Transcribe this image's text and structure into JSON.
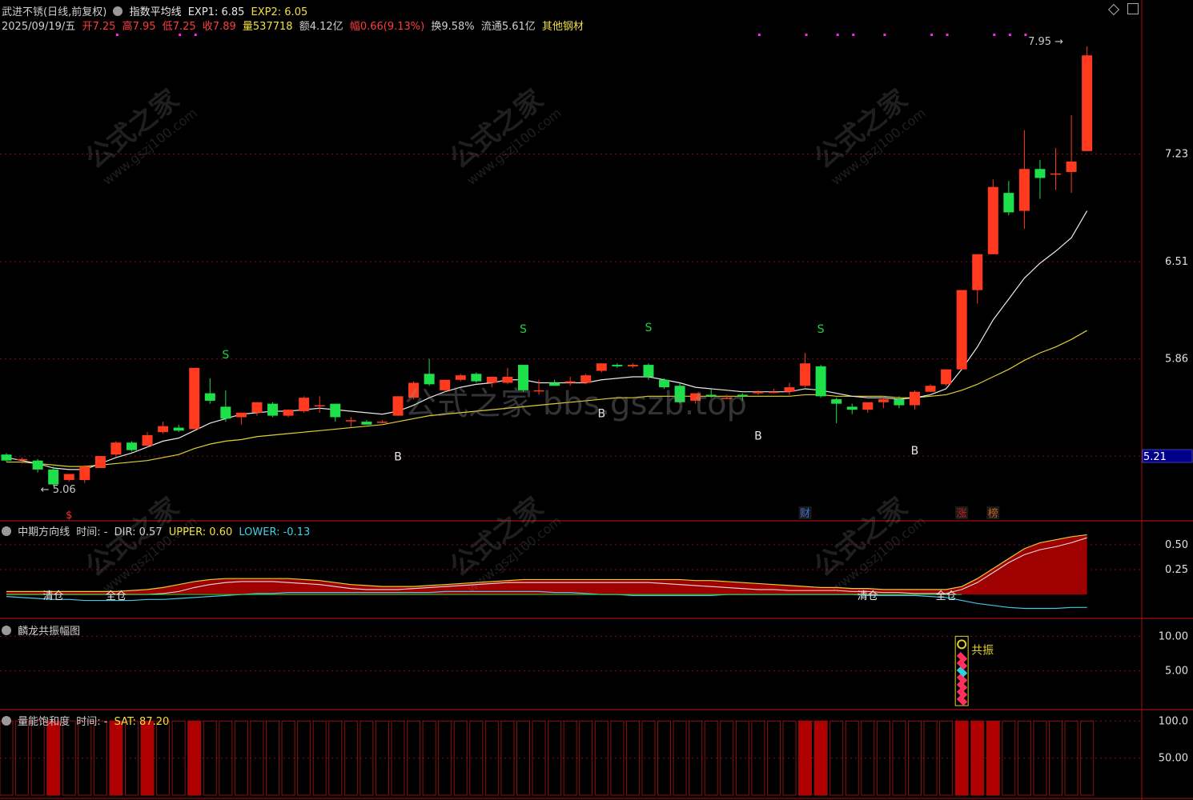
{
  "header": {
    "title": "武进不锈(日线,前复权)",
    "indicator_name": "指数平均线",
    "exp1_label": "EXP1: 6.85",
    "exp2_label": "EXP2: 6.05",
    "date": "2025/09/19/五",
    "open_label": "开",
    "open": "7.25",
    "high_label": "高",
    "high": "7.95",
    "low_label": "低",
    "low": "7.25",
    "close_label": "收",
    "close": "7.89",
    "vol_label": "量",
    "vol": "537718",
    "amount_label": "额",
    "amount": "4.12亿",
    "change_label": "幅",
    "change": "0.66(9.13%)",
    "turnover_label": "换",
    "turnover": "9.58%",
    "float_label": "流通",
    "float": "5.61亿",
    "sector": "其他钢材"
  },
  "colors": {
    "up": "#ff3a1e",
    "down": "#1ee04a",
    "ma1": "#e8e8e8",
    "ma2": "#e0d030",
    "grid": "#7a1010",
    "fill": "#b00000",
    "cyan": "#40c8e0"
  },
  "panes": {
    "mid": {
      "name": "中期方向线",
      "time": "时间: -",
      "dir": "DIR: 0.57",
      "upper": "UPPER: 0.60",
      "lower": "LOWER: -0.13",
      "signals": [
        "清仓",
        "全仓",
        "清仓",
        "全仓"
      ]
    },
    "res": {
      "name": "麟龙共振幅图",
      "tag": "共振"
    },
    "sat": {
      "name": "量能饱和度",
      "time": "时间: -",
      "value": "SAT: 87.20"
    }
  },
  "markers": {
    "low_label": "5.06",
    "high_label": "7.95",
    "current_price": "5.21",
    "badges": [
      "财",
      "涨",
      "榜"
    ],
    "sell": "S",
    "buy": "B",
    "dollar": "$"
  },
  "watermarks": {
    "cn": "公式之家",
    "url": "www.gszj100.com",
    "center": "公式之家 bbs.gszb.top"
  },
  "chart_data": [
    {
      "type": "candlestick",
      "title": "武进不锈(日线,前复权)",
      "y_ticks": [
        7.23,
        6.51,
        5.86,
        5.21
      ],
      "ylim": [
        4.9,
        7.95
      ],
      "candles": [
        {
          "o": 5.22,
          "h": 5.23,
          "c": 5.18,
          "l": 5.17
        },
        {
          "o": 5.19,
          "h": 5.2,
          "c": 5.19,
          "l": 5.16
        },
        {
          "o": 5.18,
          "h": 5.19,
          "c": 5.12,
          "l": 5.1
        },
        {
          "o": 5.12,
          "h": 5.14,
          "c": 5.02,
          "l": 5.01
        },
        {
          "o": 5.05,
          "h": 5.09,
          "c": 5.09,
          "l": 5.04
        },
        {
          "o": 5.05,
          "h": 5.15,
          "c": 5.14,
          "l": 5.03
        },
        {
          "o": 5.13,
          "h": 5.21,
          "c": 5.21,
          "l": 5.13
        },
        {
          "o": 5.22,
          "h": 5.31,
          "c": 5.3,
          "l": 5.21
        },
        {
          "o": 5.3,
          "h": 5.31,
          "c": 5.25,
          "l": 5.24
        },
        {
          "o": 5.28,
          "h": 5.37,
          "c": 5.35,
          "l": 5.27
        },
        {
          "o": 5.37,
          "h": 5.44,
          "c": 5.41,
          "l": 5.36
        },
        {
          "o": 5.4,
          "h": 5.42,
          "c": 5.38,
          "l": 5.37
        },
        {
          "o": 5.39,
          "h": 5.8,
          "c": 5.8,
          "l": 5.39
        },
        {
          "o": 5.63,
          "h": 5.73,
          "c": 5.58,
          "l": 5.56
        },
        {
          "o": 5.54,
          "h": 5.65,
          "c": 5.46,
          "l": 5.44
        },
        {
          "o": 5.47,
          "h": 5.5,
          "c": 5.5,
          "l": 5.42
        },
        {
          "o": 5.5,
          "h": 5.57,
          "c": 5.57,
          "l": 5.48
        },
        {
          "o": 5.56,
          "h": 5.57,
          "c": 5.48,
          "l": 5.47
        },
        {
          "o": 5.48,
          "h": 5.52,
          "c": 5.52,
          "l": 5.47
        },
        {
          "o": 5.51,
          "h": 5.61,
          "c": 5.6,
          "l": 5.5
        },
        {
          "o": 5.55,
          "h": 5.61,
          "c": 5.55,
          "l": 5.5
        },
        {
          "o": 5.56,
          "h": 5.56,
          "c": 5.47,
          "l": 5.44
        },
        {
          "o": 5.45,
          "h": 5.47,
          "c": 5.45,
          "l": 5.4
        },
        {
          "o": 5.44,
          "h": 5.45,
          "c": 5.42,
          "l": 5.42
        },
        {
          "o": 5.44,
          "h": 5.45,
          "c": 5.44,
          "l": 5.43
        },
        {
          "o": 5.48,
          "h": 5.61,
          "c": 5.61,
          "l": 5.48
        },
        {
          "o": 5.6,
          "h": 5.71,
          "c": 5.7,
          "l": 5.59
        },
        {
          "o": 5.76,
          "h": 5.86,
          "c": 5.69,
          "l": 5.68
        },
        {
          "o": 5.65,
          "h": 5.72,
          "c": 5.72,
          "l": 5.64
        },
        {
          "o": 5.72,
          "h": 5.76,
          "c": 5.75,
          "l": 5.71
        },
        {
          "o": 5.76,
          "h": 5.77,
          "c": 5.71,
          "l": 5.7
        },
        {
          "o": 5.7,
          "h": 5.74,
          "c": 5.74,
          "l": 5.67
        },
        {
          "o": 5.7,
          "h": 5.8,
          "c": 5.74,
          "l": 5.69
        },
        {
          "o": 5.82,
          "h": 5.82,
          "c": 5.65,
          "l": 5.64
        },
        {
          "o": 5.65,
          "h": 5.72,
          "c": 5.65,
          "l": 5.62
        },
        {
          "o": 5.7,
          "h": 5.72,
          "c": 5.68,
          "l": 5.68
        },
        {
          "o": 5.7,
          "h": 5.74,
          "c": 5.71,
          "l": 5.68
        },
        {
          "o": 5.7,
          "h": 5.76,
          "c": 5.75,
          "l": 5.69
        },
        {
          "o": 5.78,
          "h": 5.83,
          "c": 5.83,
          "l": 5.77
        },
        {
          "o": 5.82,
          "h": 5.83,
          "c": 5.81,
          "l": 5.8
        },
        {
          "o": 5.81,
          "h": 5.83,
          "c": 5.82,
          "l": 5.8
        },
        {
          "o": 5.82,
          "h": 5.83,
          "c": 5.74,
          "l": 5.72
        },
        {
          "o": 5.72,
          "h": 5.73,
          "c": 5.67,
          "l": 5.66
        },
        {
          "o": 5.68,
          "h": 5.7,
          "c": 5.57,
          "l": 5.56
        },
        {
          "o": 5.58,
          "h": 5.63,
          "c": 5.63,
          "l": 5.56
        },
        {
          "o": 5.62,
          "h": 5.66,
          "c": 5.61,
          "l": 5.6
        },
        {
          "o": 5.6,
          "h": 5.62,
          "c": 5.6,
          "l": 5.59
        },
        {
          "o": 5.62,
          "h": 5.63,
          "c": 5.61,
          "l": 5.58
        },
        {
          "o": 5.63,
          "h": 5.65,
          "c": 5.64,
          "l": 5.62
        },
        {
          "o": 5.64,
          "h": 5.66,
          "c": 5.64,
          "l": 5.63
        },
        {
          "o": 5.64,
          "h": 5.7,
          "c": 5.67,
          "l": 5.62
        },
        {
          "o": 5.68,
          "h": 5.9,
          "c": 5.83,
          "l": 5.67
        },
        {
          "o": 5.81,
          "h": 5.82,
          "c": 5.61,
          "l": 5.6
        },
        {
          "o": 5.59,
          "h": 5.6,
          "c": 5.56,
          "l": 5.43
        },
        {
          "o": 5.54,
          "h": 5.56,
          "c": 5.52,
          "l": 5.49
        },
        {
          "o": 5.52,
          "h": 5.57,
          "c": 5.57,
          "l": 5.5
        },
        {
          "o": 5.57,
          "h": 5.61,
          "c": 5.59,
          "l": 5.53
        },
        {
          "o": 5.59,
          "h": 5.61,
          "c": 5.55,
          "l": 5.53
        },
        {
          "o": 5.55,
          "h": 5.65,
          "c": 5.64,
          "l": 5.52
        },
        {
          "o": 5.64,
          "h": 5.69,
          "c": 5.68,
          "l": 5.64
        },
        {
          "o": 5.69,
          "h": 5.79,
          "c": 5.79,
          "l": 5.68
        },
        {
          "o": 5.79,
          "h": 6.32,
          "c": 6.32,
          "l": 5.79
        },
        {
          "o": 6.32,
          "h": 6.56,
          "c": 6.56,
          "l": 6.23
        },
        {
          "o": 6.56,
          "h": 7.06,
          "c": 7.01,
          "l": 6.56
        },
        {
          "o": 6.97,
          "h": 7.05,
          "c": 6.84,
          "l": 6.82
        },
        {
          "o": 6.85,
          "h": 7.39,
          "c": 7.13,
          "l": 6.73
        },
        {
          "o": 7.13,
          "h": 7.19,
          "c": 7.07,
          "l": 6.93
        },
        {
          "o": 7.1,
          "h": 7.27,
          "c": 7.1,
          "l": 6.99
        },
        {
          "o": 7.11,
          "h": 7.49,
          "c": 7.18,
          "l": 6.97
        },
        {
          "o": 7.25,
          "h": 7.95,
          "c": 7.89,
          "l": 7.25
        }
      ],
      "ma_white": [
        5.2,
        5.18,
        5.16,
        5.13,
        5.12,
        5.12,
        5.16,
        5.2,
        5.23,
        5.27,
        5.31,
        5.33,
        5.38,
        5.43,
        5.46,
        5.49,
        5.5,
        5.51,
        5.51,
        5.52,
        5.53,
        5.52,
        5.51,
        5.5,
        5.49,
        5.51,
        5.55,
        5.6,
        5.64,
        5.67,
        5.69,
        5.7,
        5.72,
        5.72,
        5.7,
        5.7,
        5.7,
        5.7,
        5.72,
        5.73,
        5.74,
        5.74,
        5.72,
        5.7,
        5.67,
        5.66,
        5.65,
        5.64,
        5.64,
        5.64,
        5.64,
        5.66,
        5.65,
        5.63,
        5.61,
        5.6,
        5.6,
        5.59,
        5.6,
        5.62,
        5.66,
        5.79,
        5.94,
        6.12,
        6.26,
        6.4,
        6.5,
        6.58,
        6.67,
        6.85
      ],
      "ma_yellow": [
        5.17,
        5.17,
        5.16,
        5.15,
        5.14,
        5.14,
        5.15,
        5.16,
        5.17,
        5.18,
        5.2,
        5.22,
        5.26,
        5.29,
        5.31,
        5.32,
        5.34,
        5.35,
        5.36,
        5.37,
        5.38,
        5.39,
        5.4,
        5.41,
        5.42,
        5.44,
        5.46,
        5.48,
        5.49,
        5.5,
        5.51,
        5.52,
        5.53,
        5.54,
        5.55,
        5.56,
        5.57,
        5.58,
        5.59,
        5.6,
        5.6,
        5.61,
        5.61,
        5.61,
        5.61,
        5.61,
        5.61,
        5.61,
        5.61,
        5.61,
        5.61,
        5.62,
        5.62,
        5.61,
        5.61,
        5.61,
        5.61,
        5.6,
        5.6,
        5.61,
        5.62,
        5.65,
        5.69,
        5.74,
        5.79,
        5.85,
        5.9,
        5.94,
        5.99,
        6.05
      ]
    },
    {
      "type": "area",
      "title": "中期方向线",
      "y_ticks": [
        0.5,
        0.25
      ],
      "dir": [
        0.0,
        0.0,
        0.0,
        0.0,
        0.0,
        0.0,
        0.0,
        0.0,
        0.0,
        0.0,
        0.01,
        0.03,
        0.07,
        0.1,
        0.12,
        0.13,
        0.13,
        0.13,
        0.12,
        0.11,
        0.1,
        0.08,
        0.06,
        0.05,
        0.05,
        0.05,
        0.06,
        0.07,
        0.08,
        0.09,
        0.1,
        0.11,
        0.12,
        0.12,
        0.12,
        0.12,
        0.12,
        0.12,
        0.12,
        0.12,
        0.12,
        0.12,
        0.11,
        0.1,
        0.09,
        0.08,
        0.07,
        0.06,
        0.05,
        0.05,
        0.04,
        0.04,
        0.04,
        0.04,
        0.03,
        0.03,
        0.02,
        0.02,
        0.01,
        0.01,
        0.01,
        0.05,
        0.12,
        0.22,
        0.32,
        0.4,
        0.45,
        0.48,
        0.52,
        0.57
      ],
      "upper": [
        0.03,
        0.03,
        0.03,
        0.03,
        0.03,
        0.03,
        0.03,
        0.03,
        0.04,
        0.05,
        0.07,
        0.1,
        0.13,
        0.15,
        0.16,
        0.16,
        0.16,
        0.16,
        0.16,
        0.15,
        0.14,
        0.12,
        0.1,
        0.09,
        0.08,
        0.08,
        0.08,
        0.09,
        0.1,
        0.11,
        0.12,
        0.13,
        0.14,
        0.15,
        0.15,
        0.15,
        0.15,
        0.15,
        0.15,
        0.15,
        0.15,
        0.15,
        0.15,
        0.15,
        0.14,
        0.14,
        0.13,
        0.12,
        0.11,
        0.1,
        0.09,
        0.08,
        0.07,
        0.07,
        0.06,
        0.06,
        0.05,
        0.05,
        0.05,
        0.05,
        0.05,
        0.08,
        0.16,
        0.26,
        0.36,
        0.46,
        0.52,
        0.55,
        0.58,
        0.6
      ],
      "lower": [
        -0.02,
        -0.03,
        -0.04,
        -0.05,
        -0.05,
        -0.06,
        -0.06,
        -0.06,
        -0.06,
        -0.05,
        -0.05,
        -0.04,
        -0.03,
        -0.02,
        -0.01,
        0.0,
        0.01,
        0.01,
        0.02,
        0.02,
        0.02,
        0.02,
        0.02,
        0.02,
        0.02,
        0.02,
        0.02,
        0.02,
        0.03,
        0.03,
        0.03,
        0.03,
        0.03,
        0.03,
        0.03,
        0.02,
        0.02,
        0.01,
        0.0,
        0.0,
        -0.01,
        -0.01,
        -0.01,
        -0.01,
        -0.01,
        -0.01,
        0.0,
        0.0,
        0.0,
        0.0,
        0.0,
        0.0,
        0.0,
        0.0,
        0.0,
        -0.01,
        -0.01,
        -0.01,
        -0.01,
        -0.02,
        -0.03,
        -0.06,
        -0.09,
        -0.11,
        -0.13,
        -0.14,
        -0.14,
        -0.14,
        -0.13,
        -0.13
      ],
      "signals": [
        {
          "i": 3,
          "t": "清仓"
        },
        {
          "i": 7,
          "t": "全仓"
        },
        {
          "i": 55,
          "t": "清仓"
        },
        {
          "i": 60,
          "t": "全仓"
        }
      ]
    },
    {
      "type": "bar",
      "title": "麟龙共振幅图",
      "y_ticks": [
        10.0,
        5.0
      ],
      "bars": [
        {
          "i": 61,
          "value": 10.0
        }
      ]
    },
    {
      "type": "bar",
      "title": "量能饱和度",
      "y_ticks": [
        100.0,
        50.0
      ],
      "filled": [
        3,
        7,
        9,
        12,
        51,
        52,
        61,
        62,
        63
      ],
      "values": [
        100,
        100,
        100,
        100,
        100,
        100,
        100,
        100,
        100,
        100,
        100,
        100,
        100,
        100,
        100,
        100,
        100,
        100,
        100,
        100,
        100,
        100,
        100,
        100,
        100,
        100,
        100,
        100,
        100,
        100,
        100,
        100,
        100,
        100,
        100,
        100,
        100,
        100,
        100,
        100,
        100,
        100,
        100,
        100,
        100,
        100,
        100,
        100,
        100,
        100,
        100,
        100,
        100,
        100,
        100,
        100,
        100,
        100,
        100,
        100,
        100,
        100,
        100,
        100,
        100,
        100,
        100,
        100,
        100,
        100
      ]
    }
  ],
  "signals_main": {
    "sell_idx": [
      14,
      33,
      41,
      52
    ],
    "buy_idx": [
      25,
      38,
      48,
      58
    ],
    "magenta_dots_idx": [
      7,
      11,
      12,
      48,
      51,
      53,
      54,
      56,
      59,
      60,
      63,
      64,
      65
    ]
  }
}
